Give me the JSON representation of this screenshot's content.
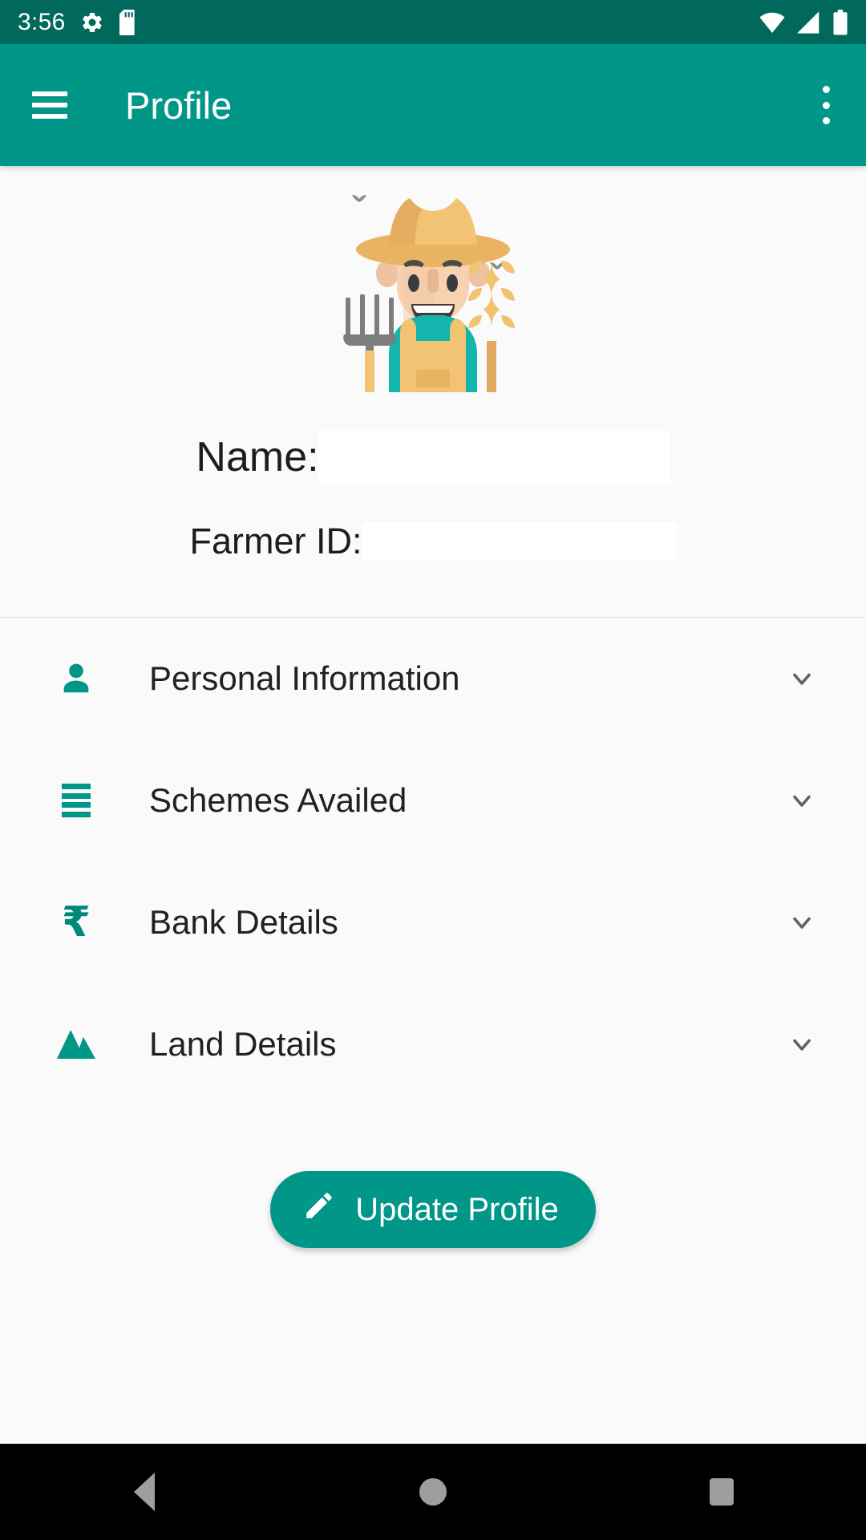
{
  "status_bar": {
    "clock": "3:56",
    "icons": [
      "gear-icon",
      "sd-card-icon",
      "wifi-icon",
      "cell-signal-icon",
      "battery-icon"
    ],
    "background": "#00695c"
  },
  "app_bar": {
    "title": "Profile",
    "menu_icon": "hamburger-menu-icon",
    "overflow_icon": "overflow-menu-icon",
    "background": "#009688"
  },
  "profile": {
    "avatar": "farmer-avatar-illustration",
    "name_label": "Name:",
    "name_value": "",
    "name_placeholder": "",
    "farmer_id_label": "Farmer ID:",
    "farmer_id_value": "",
    "farmer_id_placeholder": ""
  },
  "sections": [
    {
      "label": "Personal Information",
      "icon": "person-icon",
      "expand_icon": "chevron-down-icon"
    },
    {
      "label": "Schemes Availed",
      "icon": "list-bars-icon",
      "expand_icon": "chevron-down-icon"
    },
    {
      "label": "Bank Details",
      "icon": "rupee-icon",
      "expand_icon": "chevron-down-icon"
    },
    {
      "label": "Land Details",
      "icon": "mountain-icon",
      "expand_icon": "chevron-down-icon"
    }
  ],
  "update_button": {
    "label": "Update Profile",
    "icon": "pencil-icon",
    "color": "#009688"
  },
  "nav_bar": {
    "back": "back-triangle-icon",
    "home": "home-circle-icon",
    "recents": "recents-square-icon",
    "background": "#000000"
  },
  "colors": {
    "status_bar": "#00695c",
    "primary": "#009688",
    "accent_icon": "#00897b",
    "page_background": "#fafafa",
    "text": "#212121",
    "chevron": "#616161"
  }
}
